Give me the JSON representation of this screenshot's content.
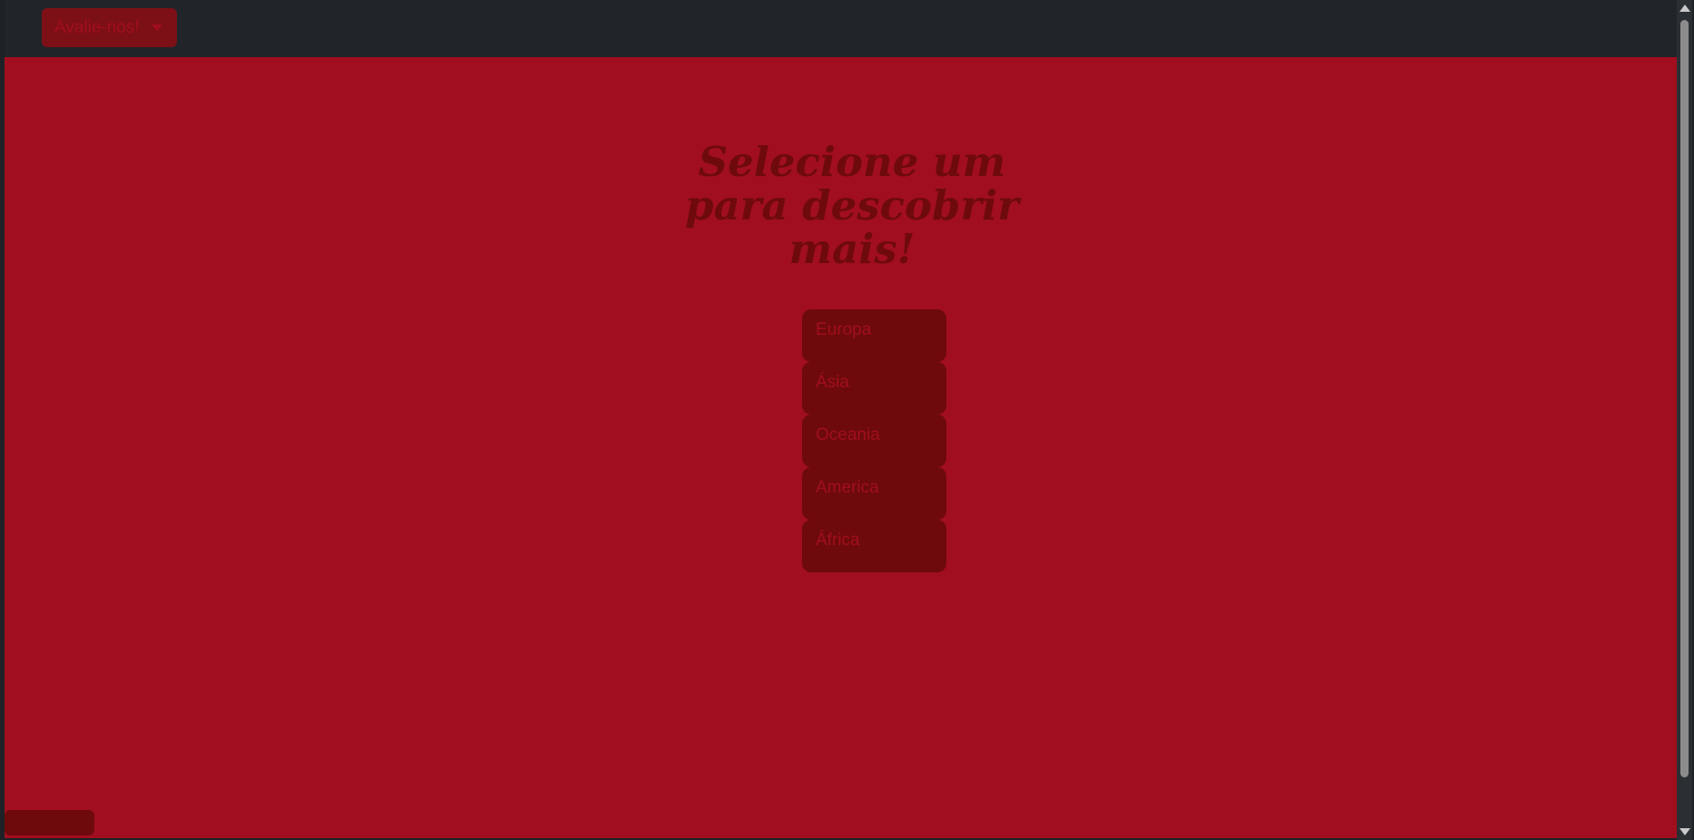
{
  "navbar": {
    "rate_button_label": "Avalie-nos!",
    "rate_button_icon": "caret-down-icon"
  },
  "main": {
    "heading": "Selecione um para descobrir mais!",
    "continents": [
      {
        "label": "Europa"
      },
      {
        "label": "Ásia"
      },
      {
        "label": "Oceania"
      },
      {
        "label": "America"
      },
      {
        "label": "África"
      }
    ]
  },
  "colors": {
    "navbar_bg": "#212529",
    "page_bg": "#a10e1f",
    "button_bg": "#6e0a0b",
    "heading_color": "#6e0a0c"
  }
}
